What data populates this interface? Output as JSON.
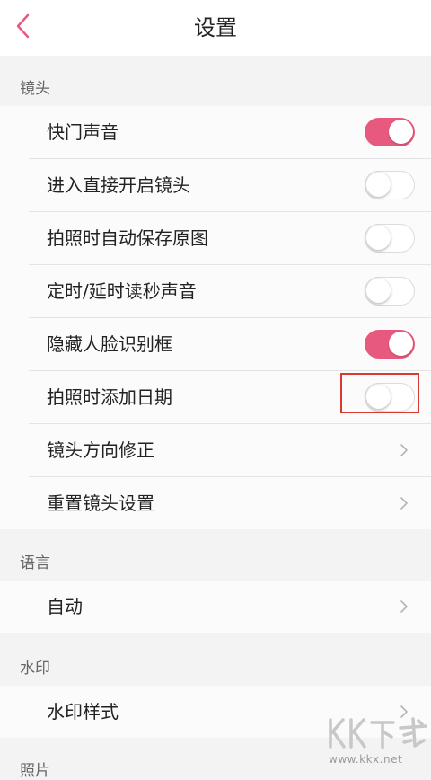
{
  "header": {
    "title": "设置",
    "back_icon": "chevron-left-icon",
    "accent": "#e8597f"
  },
  "sections": {
    "lens": {
      "label": "镜头",
      "items": [
        {
          "label": "快门声音",
          "type": "toggle",
          "on": true
        },
        {
          "label": "进入直接开启镜头",
          "type": "toggle",
          "on": false
        },
        {
          "label": "拍照时自动保存原图",
          "type": "toggle",
          "on": false
        },
        {
          "label": "定时/延时读秒声音",
          "type": "toggle",
          "on": false
        },
        {
          "label": "隐藏人脸识别框",
          "type": "toggle",
          "on": true
        },
        {
          "label": "拍照时添加日期",
          "type": "toggle",
          "on": false,
          "highlighted": true
        },
        {
          "label": "镜头方向修正",
          "type": "link"
        },
        {
          "label": "重置镜头设置",
          "type": "link"
        }
      ]
    },
    "language": {
      "label": "语言",
      "items": [
        {
          "label": "自动",
          "type": "link"
        }
      ]
    },
    "watermark": {
      "label": "水印",
      "items": [
        {
          "label": "水印样式",
          "type": "link"
        }
      ]
    },
    "photo": {
      "label": "照片"
    }
  },
  "colors": {
    "toggle_on": "#e8597f",
    "highlight_box": "#d93a2f"
  },
  "site_watermark": {
    "logo_text": "KK下载",
    "url": "www.kkx.net"
  }
}
